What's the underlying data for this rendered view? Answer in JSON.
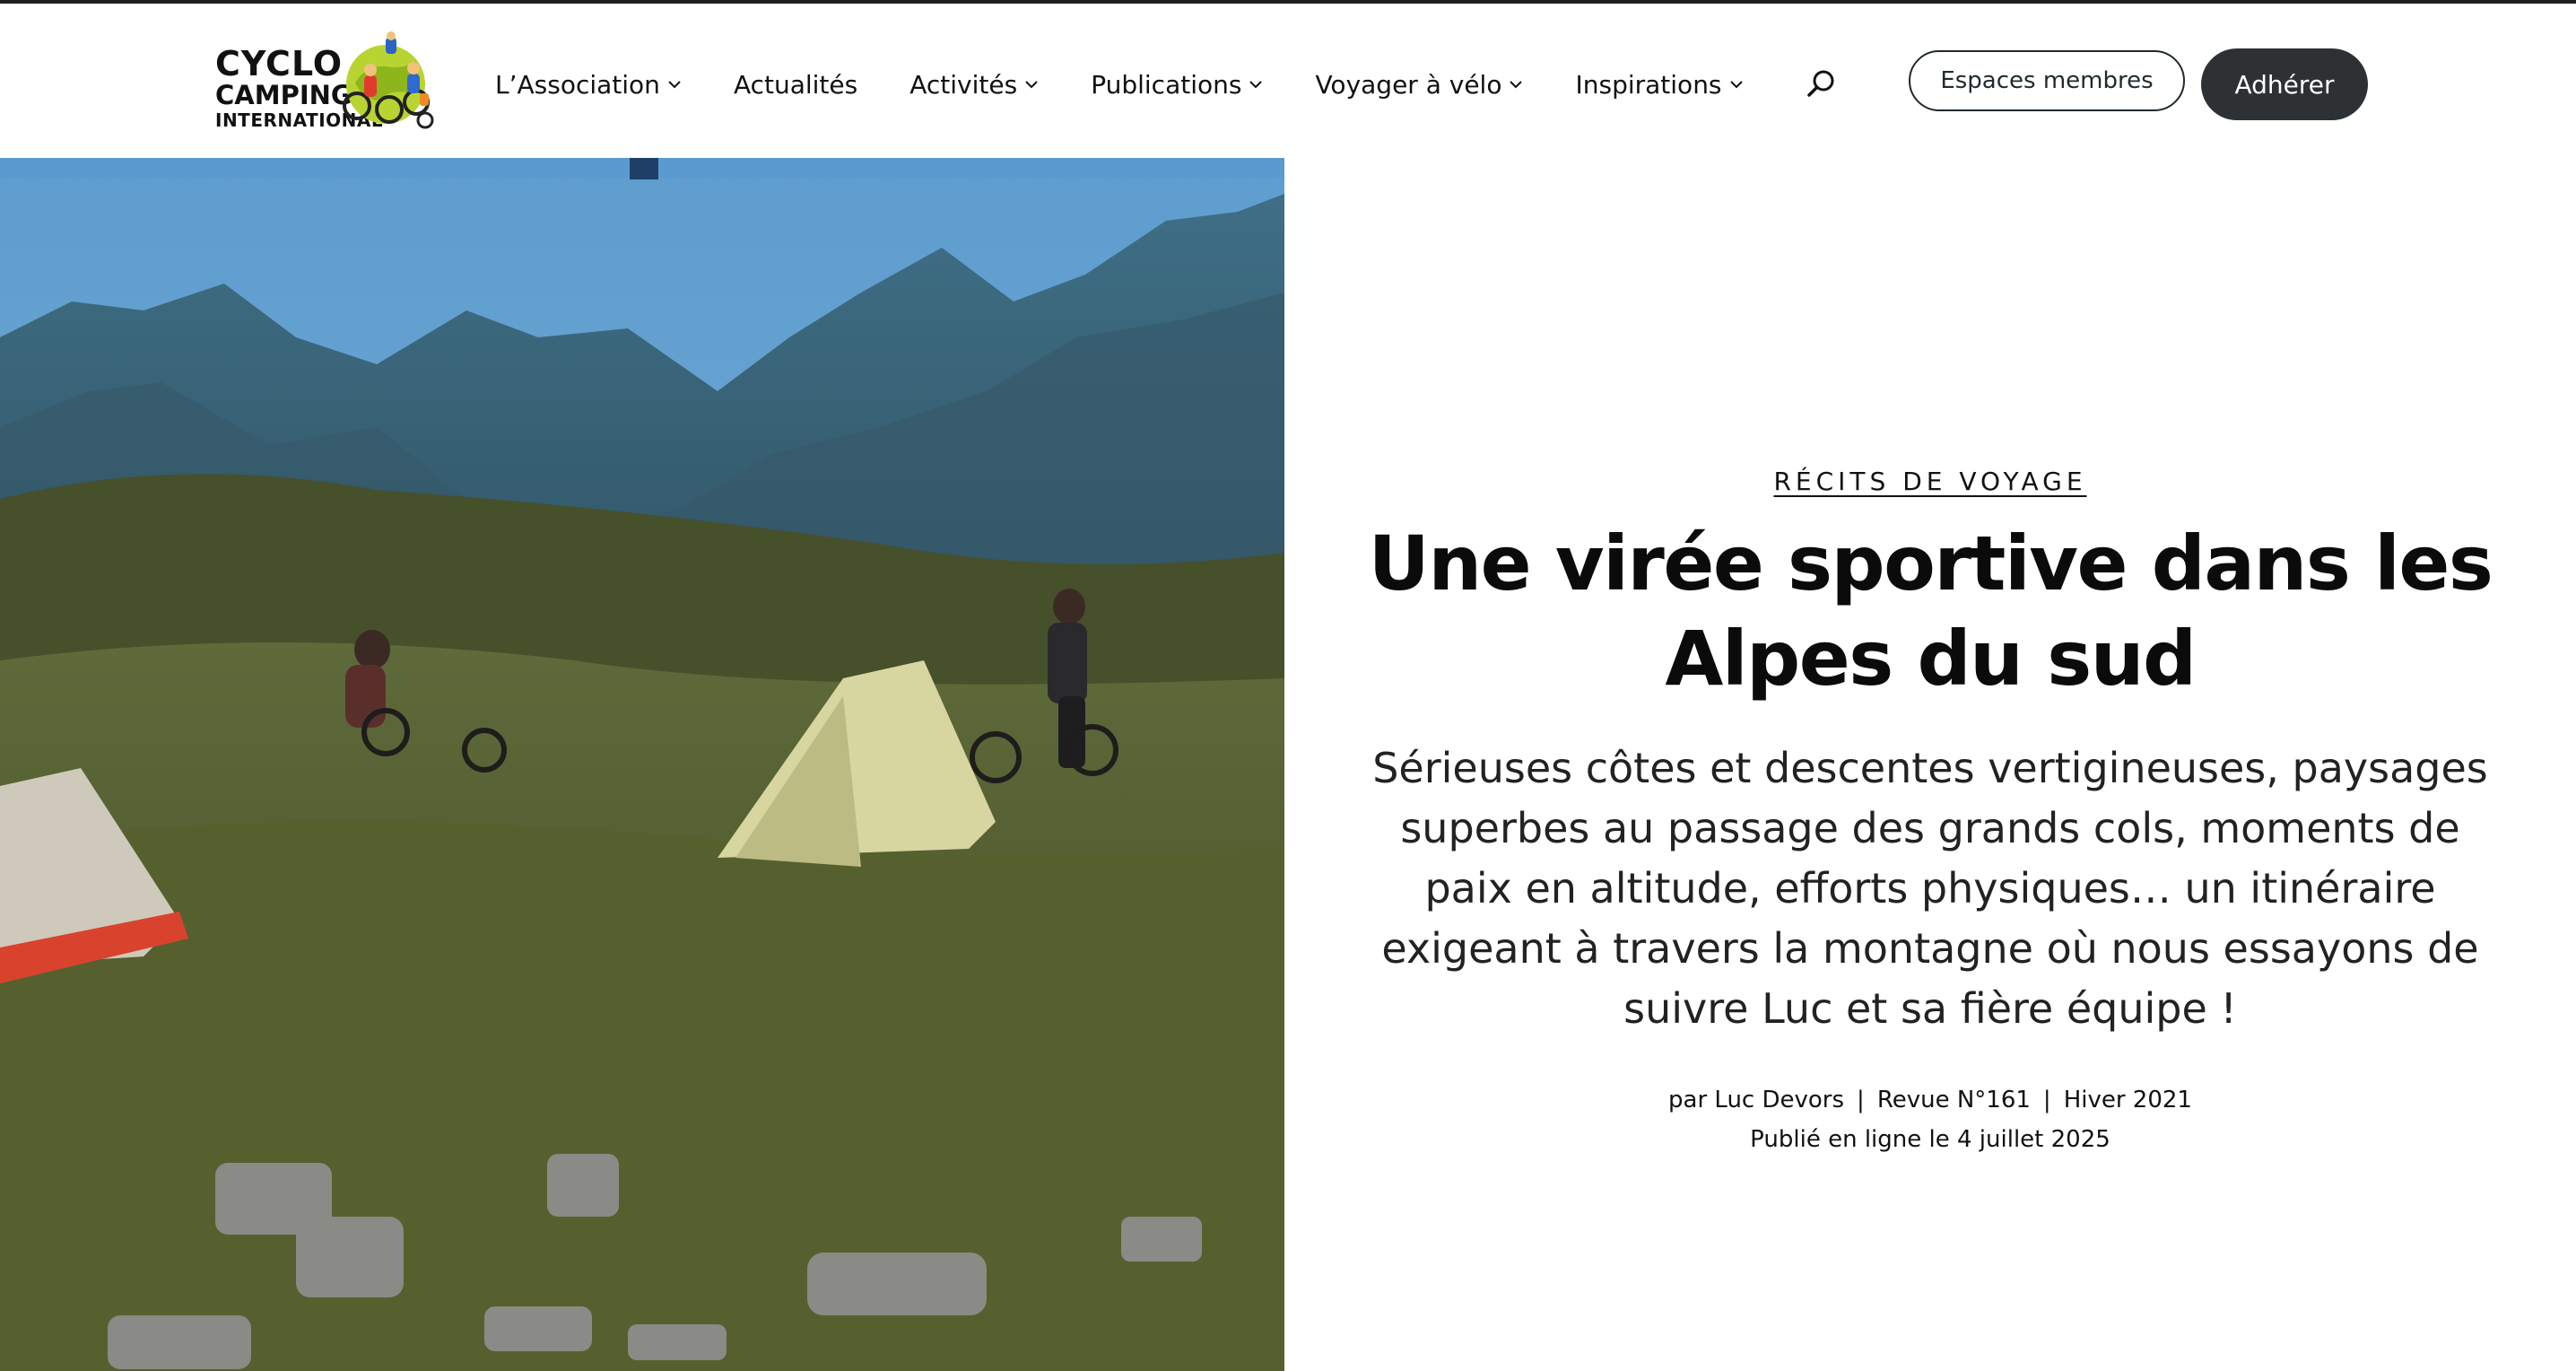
{
  "logo": {
    "line1": "CYCLO",
    "line2": "CAMPING",
    "line3": "INTERNATIONAL"
  },
  "nav": {
    "items": [
      {
        "label": "L’Association",
        "dropdown": true
      },
      {
        "label": "Actualités",
        "dropdown": false
      },
      {
        "label": "Activités",
        "dropdown": true
      },
      {
        "label": "Publications",
        "dropdown": true
      },
      {
        "label": "Voyager à vélo",
        "dropdown": true
      },
      {
        "label": "Inspirations",
        "dropdown": true
      }
    ]
  },
  "header": {
    "members_label": "Espaces membres",
    "join_label": "Adhérer"
  },
  "icons": {
    "search": "search-icon",
    "chevron": "chevron-down-icon"
  },
  "article": {
    "category": "RÉCITS DE VOYAGE",
    "title": "Une virée sportive dans les Alpes du sud",
    "summary": "Sérieuses côtes et descentes vertigineuses, paysages superbes au passage des grands cols, moments de paix en altitude, efforts physiques… un itinéraire exigeant à travers la montagne où nous essayons de suivre Luc et sa fière équipe !",
    "author": "par Luc Devors",
    "issue": "Revue N°161",
    "season": "Hiver 2021",
    "published": "Publié en ligne le 4 juillet 2025"
  },
  "colors": {
    "dark_button": "#2e3134",
    "text": "#111111",
    "sky": "#6aa2cf"
  }
}
